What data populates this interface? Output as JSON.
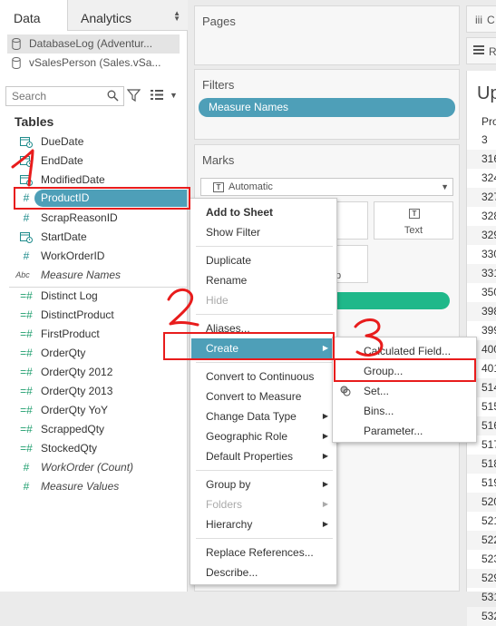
{
  "data_pane": {
    "tabs": {
      "data": "Data",
      "analytics": "Analytics"
    },
    "data_sources": [
      "DatabaseLog (Adventur...",
      "vSalesPerson (Sales.vSa..."
    ],
    "search_placeholder": "Search",
    "tables_heading": "Tables",
    "fields": [
      {
        "label": "DueDate",
        "icon": "calendar-icon"
      },
      {
        "label": "EndDate",
        "icon": "calendar-icon"
      },
      {
        "label": "ModifiedDate",
        "icon": "calendar-icon"
      },
      {
        "label": "ProductID",
        "icon": "hash-icon",
        "selected": true
      },
      {
        "label": "ScrapReasonID",
        "icon": "hash-icon"
      },
      {
        "label": "StartDate",
        "icon": "calendar-icon"
      },
      {
        "label": "WorkOrderID",
        "icon": "hash-icon"
      },
      {
        "label": "Measure Names",
        "icon": "abc-icon",
        "italic": true
      },
      {
        "label": "Distinct Log",
        "icon": "measure-hash-icon"
      },
      {
        "label": "DistinctProduct",
        "icon": "measure-hash-icon"
      },
      {
        "label": "FirstProduct",
        "icon": "measure-hash-icon"
      },
      {
        "label": "OrderQty",
        "icon": "measure-hash-icon"
      },
      {
        "label": "OrderQty 2012",
        "icon": "measure-hash-icon"
      },
      {
        "label": "OrderQty 2013",
        "icon": "measure-hash-icon"
      },
      {
        "label": "OrderQty YoY",
        "icon": "measure-hash-icon"
      },
      {
        "label": "ScrappedQty",
        "icon": "measure-hash-icon"
      },
      {
        "label": "StockedQty",
        "icon": "measure-hash-icon"
      },
      {
        "label": "WorkOrder (Count)",
        "icon": "hash-icon",
        "italic": true
      },
      {
        "label": "Measure Values",
        "icon": "hash-icon",
        "italic": true
      }
    ]
  },
  "shelves": {
    "pages_title": "Pages",
    "filters_title": "Filters",
    "filter_pill": "Measure Names",
    "marks_title": "Marks",
    "marks_type": "Automatic",
    "text_button": "Text",
    "partial_button_text": "p"
  },
  "sheet": {
    "top_icon_1": "iii",
    "top_label_1": "C",
    "top_label_2": "R",
    "title": "Up",
    "column_header": "Pro",
    "values": [
      "3",
      "316",
      "324",
      "327",
      "328",
      "329",
      "330",
      "331",
      "350",
      "398",
      "399",
      "400",
      "401",
      "514",
      "515",
      "516",
      "517",
      "518",
      "519",
      "520",
      "521",
      "522",
      "523",
      "529",
      "531",
      "532"
    ]
  },
  "context_menu": {
    "items": [
      {
        "label": "Add to Sheet",
        "bold": true
      },
      {
        "label": "Show Filter"
      },
      {
        "label": "Duplicate"
      },
      {
        "label": "Rename"
      },
      {
        "label": "Hide",
        "disabled": true
      },
      {
        "label": "Aliases..."
      },
      {
        "label": "Create",
        "submenu": true,
        "highlight": true
      },
      {
        "label": "Convert to Continuous"
      },
      {
        "label": "Convert to Measure"
      },
      {
        "label": "Change Data Type",
        "submenu": true
      },
      {
        "label": "Geographic Role",
        "submenu": true
      },
      {
        "label": "Default Properties",
        "submenu": true
      },
      {
        "label": "Group by",
        "submenu": true
      },
      {
        "label": "Folders",
        "submenu": true,
        "disabled": true
      },
      {
        "label": "Hierarchy",
        "submenu": true
      },
      {
        "label": "Replace References..."
      },
      {
        "label": "Describe..."
      }
    ]
  },
  "create_submenu": {
    "items": [
      {
        "label": "Calculated Field..."
      },
      {
        "label": "Group...",
        "icon": "paperclip-icon"
      },
      {
        "label": "Set...",
        "icon": "set-icon"
      },
      {
        "label": "Bins..."
      },
      {
        "label": "Parameter..."
      }
    ]
  },
  "annotations": {
    "step_1": "1",
    "step_2": "2",
    "step_3": "3",
    "color": "#e81c1c"
  },
  "colors": {
    "accent_blue": "#4e9fb8",
    "dimension_icon": "#1e8b8b",
    "measure_icon": "#1f9e6e",
    "measure_values_pill": "#1fb88a"
  }
}
